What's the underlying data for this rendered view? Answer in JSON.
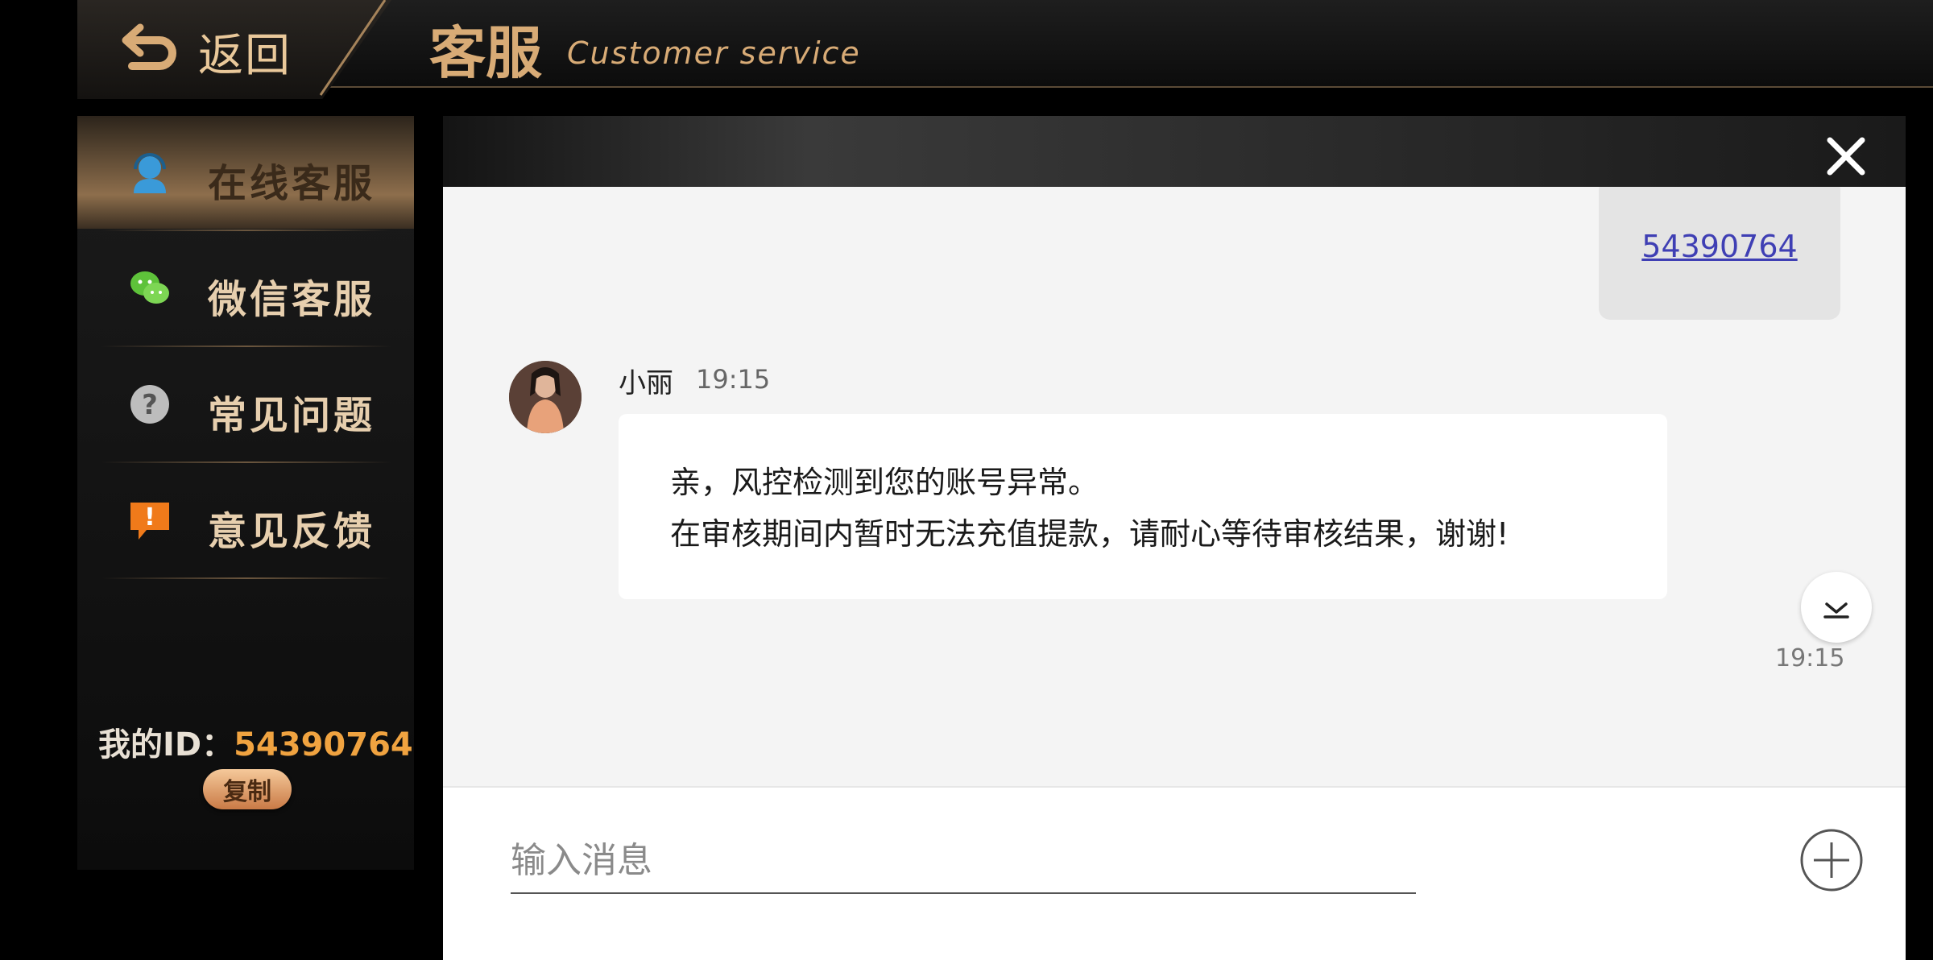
{
  "header": {
    "back_label": "返回",
    "title": "客服",
    "subtitle": "Customer service"
  },
  "sidebar": {
    "items": [
      {
        "label": "在线客服",
        "icon": "headset-user-icon",
        "active": true
      },
      {
        "label": "微信客服",
        "icon": "wechat-icon",
        "active": false
      },
      {
        "label": "常见问题",
        "icon": "question-icon",
        "active": false
      },
      {
        "label": "意见反馈",
        "icon": "feedback-exclamation-icon",
        "active": false
      }
    ],
    "my_id_label": "我的ID：",
    "my_id_value": "54390764",
    "copy_label": "复制"
  },
  "chat": {
    "outgoing_link": "54390764",
    "incoming": {
      "sender": "小丽",
      "time": "19:15",
      "lines": [
        "亲，风控检测到您的账号异常。",
        "在审核期间内暂时无法充值提款，请耐心等待审核结果，谢谢!"
      ]
    },
    "bottom_time": "19:15",
    "input_placeholder": "输入消息"
  },
  "colors": {
    "gold": "#d8ab76",
    "id_orange": "#f0a340",
    "link_blue": "#3f3fb4"
  }
}
